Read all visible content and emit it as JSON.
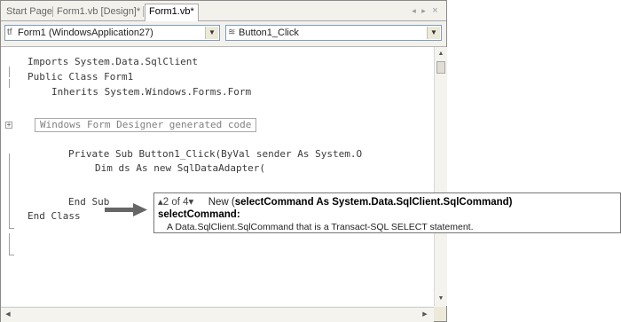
{
  "tabs": [
    {
      "label": "Start Page",
      "active": false
    },
    {
      "label": "Form1.vb [Design]*",
      "active": false
    },
    {
      "label": "Form1.vb*",
      "active": true
    }
  ],
  "window_controls": {
    "prev": "◂",
    "next": "▸",
    "close": "×"
  },
  "nav_bar": {
    "class_select": {
      "icon": "tf",
      "value": "Form1 (WindowsApplication27)"
    },
    "method_select": {
      "icon": "≋",
      "value": "Button1_Click"
    },
    "arrow": "▼"
  },
  "code": {
    "lines": [
      "Imports System.Data.SqlClient",
      "Public Class Form1",
      "Inherits System.Windows.Forms.Form",
      "Windows Form Designer generated code",
      "Private Sub Button1_Click(ByVal sender As System.O",
      "Dim ds As new SqlDataAdapter(",
      "End Sub",
      "End Class"
    ],
    "expand_glyph": "+"
  },
  "param_info": {
    "overload": "▴2 of 4▾",
    "prefix": "New (",
    "signature": "selectCommand As System.Data.SqlClient.SqlCommand)",
    "param_name": "selectCommand:",
    "description": "A Data.SqlClient.SqlCommand that is a Transact-SQL SELECT statement."
  },
  "scrollbars": {
    "up": "▲",
    "down": "▼",
    "left": "◀",
    "right": "▶"
  },
  "colors": {
    "code_text": "#3a3a3a",
    "region_text": "#808080",
    "arrow": "#666666",
    "tooltip_border": "#777777"
  }
}
